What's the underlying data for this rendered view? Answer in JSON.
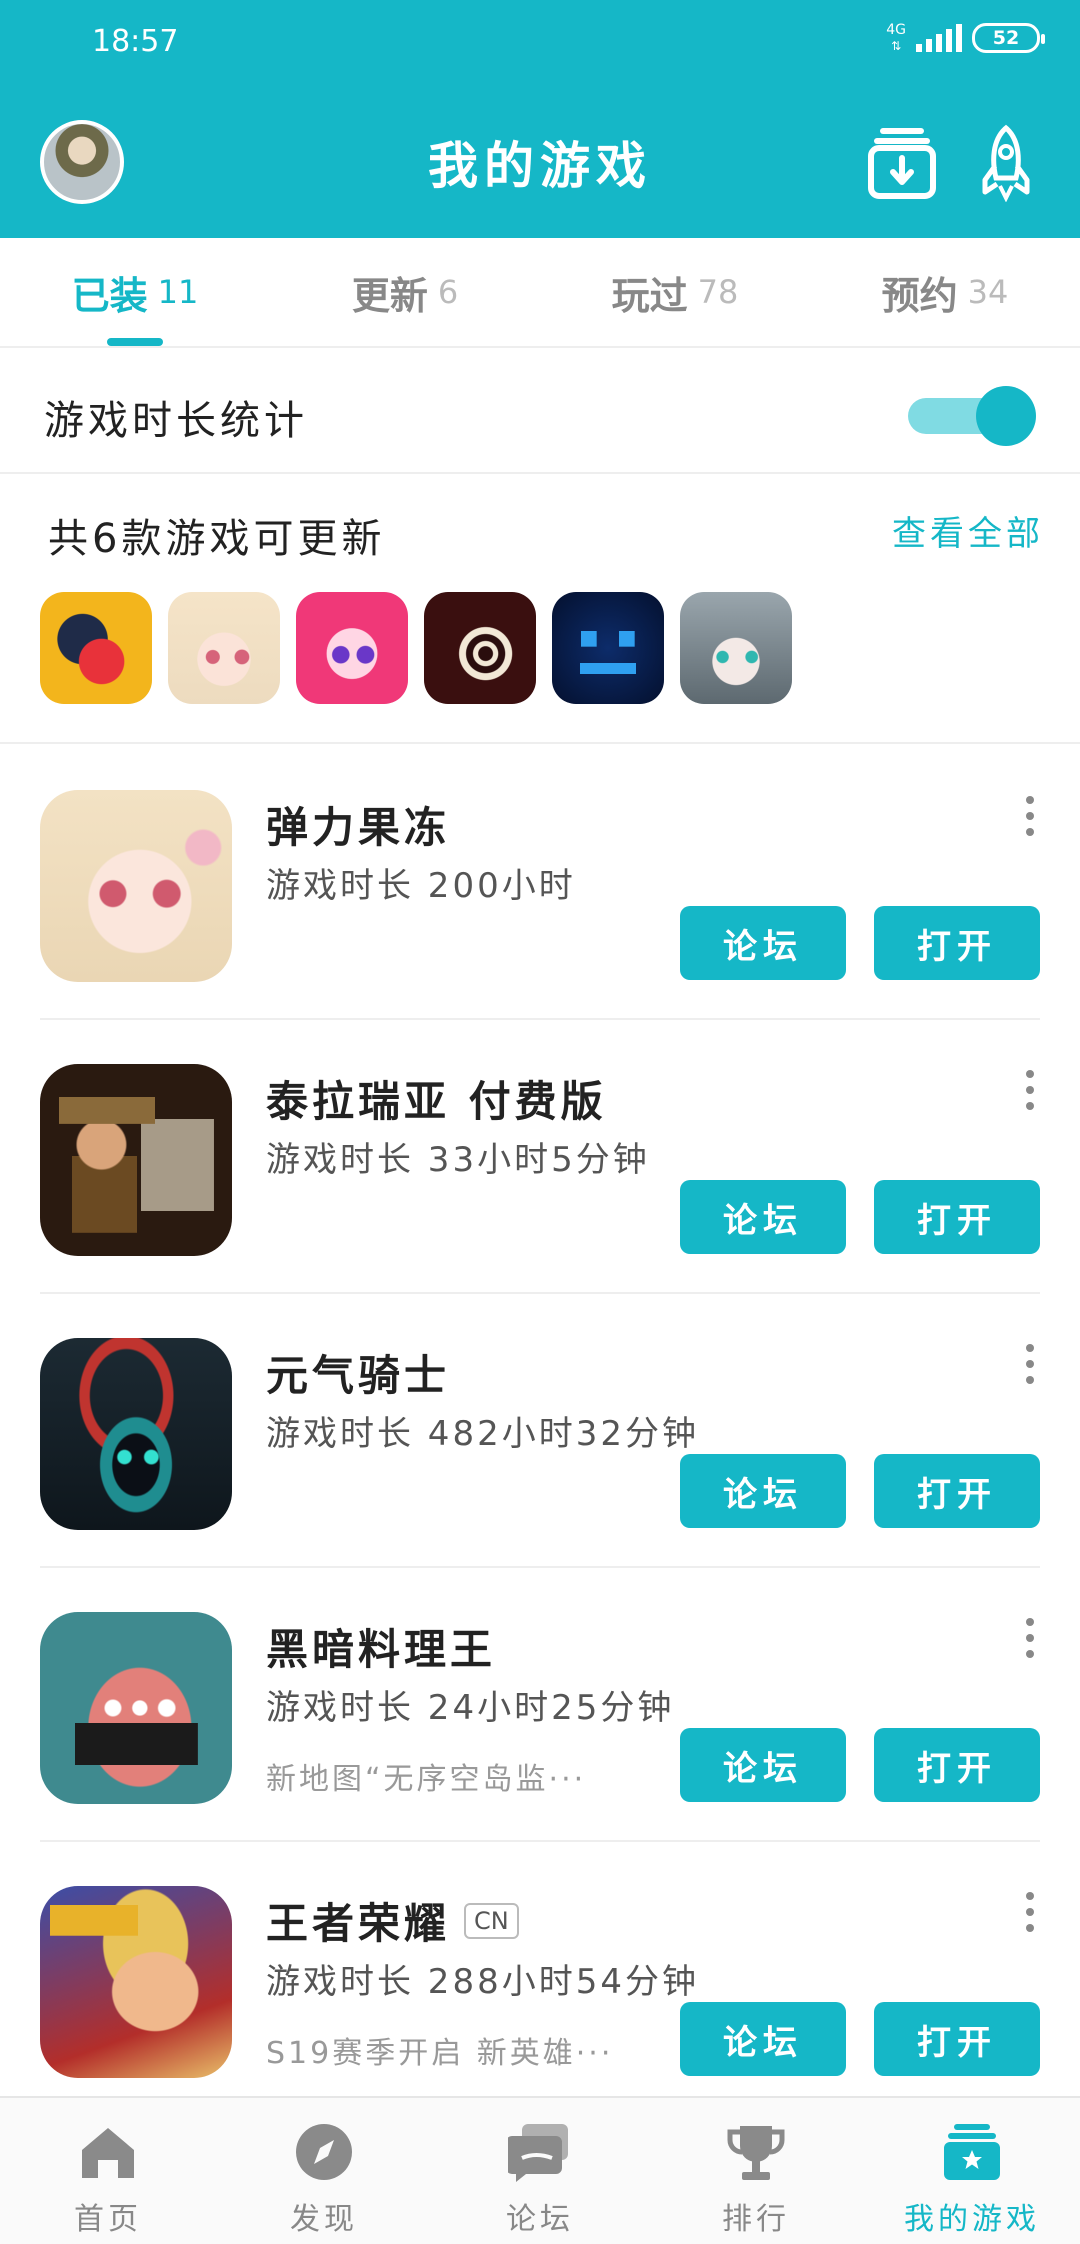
{
  "status_bar": {
    "time": "18:57",
    "network": "4G",
    "battery": "52"
  },
  "header": {
    "title": "我的游戏",
    "avatar_icon": "user-avatar",
    "download_icon": "download-box-icon",
    "rocket_icon": "rocket-icon"
  },
  "tabs": [
    {
      "label": "已装",
      "count": "11",
      "active": true
    },
    {
      "label": "更新",
      "count": "6"
    },
    {
      "label": "玩过",
      "count": "78"
    },
    {
      "label": "预约",
      "count": "34"
    }
  ],
  "stats": {
    "label": "游戏时长统计",
    "toggle_on": true
  },
  "updates": {
    "title": "共6款游戏可更新",
    "view_all": "查看全部",
    "icons": [
      "game-icon-1",
      "game-icon-2",
      "game-icon-3",
      "game-icon-4",
      "game-icon-5",
      "game-icon-6"
    ]
  },
  "games": [
    {
      "name": "弹力果冻",
      "badge": "",
      "time": "游戏时长 200小时",
      "note": "",
      "forum": "论坛",
      "open": "打开"
    },
    {
      "name": "泰拉瑞亚 付费版",
      "badge": "",
      "time": "游戏时长 33小时5分钟",
      "note": "",
      "forum": "论坛",
      "open": "打开"
    },
    {
      "name": "元气骑士",
      "badge": "",
      "time": "游戏时长 482小时32分钟",
      "note": "",
      "forum": "论坛",
      "open": "打开"
    },
    {
      "name": "黑暗料理王",
      "badge": "",
      "time": "游戏时长 24小时25分钟",
      "note": "新地图“无序空岛监···",
      "forum": "论坛",
      "open": "打开"
    },
    {
      "name": "王者荣耀",
      "badge": "CN",
      "time": "游戏时长 288小时54分钟",
      "note": "S19赛季开启 新英雄···",
      "forum": "论坛",
      "open": "打开"
    }
  ],
  "bottom_nav": [
    {
      "label": "首页",
      "icon": "home-icon"
    },
    {
      "label": "发现",
      "icon": "compass-icon"
    },
    {
      "label": "论坛",
      "icon": "forum-icon"
    },
    {
      "label": "排行",
      "icon": "trophy-icon"
    },
    {
      "label": "我的游戏",
      "icon": "my-games-icon",
      "active": true
    }
  ],
  "colors": {
    "accent": "#15b7c7",
    "divider": "#eeeeee"
  }
}
